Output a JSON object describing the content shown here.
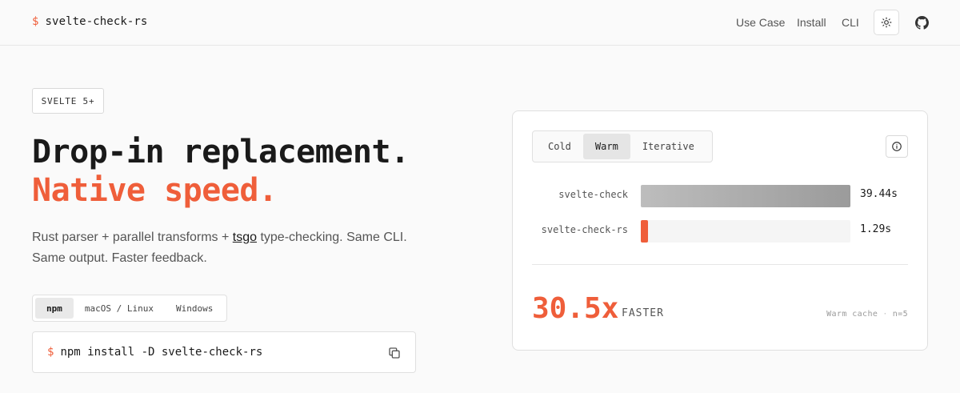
{
  "header": {
    "brand_prefix": "$",
    "brand": "svelte-check-rs",
    "nav": [
      "Use Case",
      "Install",
      "CLI"
    ],
    "icons": [
      "sun-icon",
      "github-icon"
    ]
  },
  "hero": {
    "badge": "SVELTE 5+",
    "headline_line1": "Drop-in replacement.",
    "headline_line2": "Native speed.",
    "lede_before": "Rust parser + parallel transforms + ",
    "lede_link": "tsgo",
    "lede_after": " type-checking. Same CLI. Same output. Faster feedback."
  },
  "install": {
    "tabs": [
      "npm",
      "macOS / Linux",
      "Windows"
    ],
    "active_tab": "npm",
    "prompt": "$",
    "command": "npm install -D svelte-check-rs",
    "copy_icon": "copy-icon"
  },
  "benchmark": {
    "modes": [
      "Cold",
      "Warm",
      "Iterative"
    ],
    "active_mode": "Warm",
    "info_icon": "info-icon",
    "rows": [
      {
        "label": "svelte-check",
        "value": "39.44s",
        "fraction": 1.0
      },
      {
        "label": "svelte-check-rs",
        "value": "1.29s",
        "fraction": 0.0327
      }
    ],
    "speedup": "30.5x",
    "speedup_label": "FASTER",
    "meta_left": "Warm cache",
    "meta_sep": "·",
    "meta_right": "n=5"
  },
  "colors": {
    "accent": "#ef5e3a",
    "bar_gray": "#a6a6a6"
  }
}
